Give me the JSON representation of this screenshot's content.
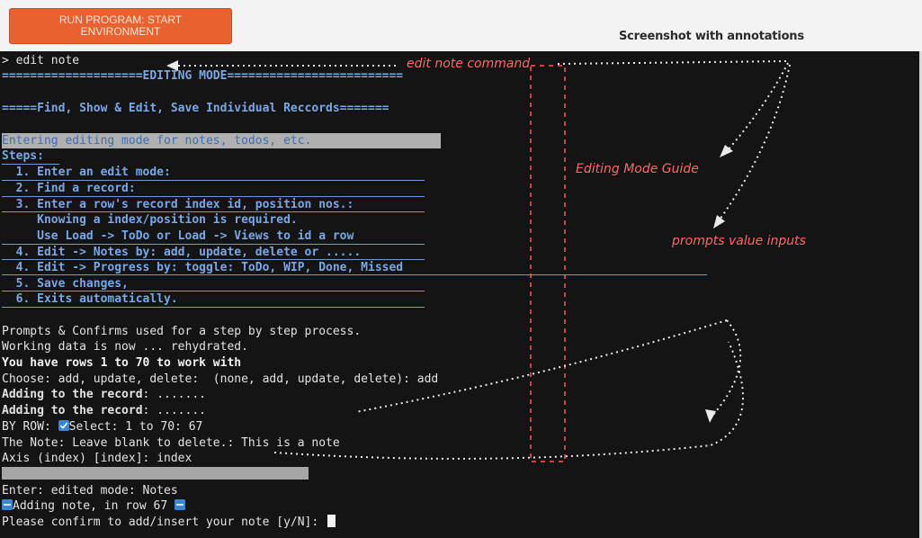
{
  "header": {
    "run_button_line1": "RUN PROGRAM: START",
    "run_button_line2": "ENVIRONMENT",
    "screenshot_caption": "Screenshot with annotations"
  },
  "terminal": {
    "command_line": "> edit note",
    "editing_mode_banner": "====================EDITING MODE=========================",
    "find_banner": "=====Find, Show & Edit, Save Individual Reccords=======",
    "entering_line": "Entering editing mode for notes, todos, etc.",
    "steps_label": "Steps:",
    "steps": [
      "  1. Enter an edit mode:",
      "  2. Find a record:",
      "  3. Enter a row's record index id, position nos.:",
      "     Knowing a index/position is required.",
      "     Use Load -> ToDo or Load -> Views to id a row",
      "  4. Edit -> Notes by: add, update, delete or .....",
      "  4. Edit -> Progress by: toggle: ToDo, WIP, Done, Missed",
      "  5. Save changes,",
      "  6. Exits automatically."
    ],
    "prompts_line": "Prompts & Confirms used for a step by step process.",
    "working_line": "Working data is now ... rehydrated.",
    "rows_line": "You have rows 1 to 70 to work with",
    "choose_prompt": "Choose: add, update, delete:  (none, add, update, delete): ",
    "choose_value": "add",
    "adding_label": "Adding to the record",
    "adding_suffix": ": .......",
    "byrow_prefix": "BY ROW: ",
    "byrow_prompt": "Select: 1 to 70: ",
    "byrow_value": "67",
    "note_prompt": "The Note: Leave blank to delete.: ",
    "note_value": "This is a note",
    "axis_prompt": "Axis (index) [index]: ",
    "axis_value": "index",
    "entered_line": "Enter: edited mode: Notes",
    "adding_note_line": "Adding note, in row 67 ",
    "confirm_prompt": "Please confirm to add/insert your note [y/N]: "
  },
  "annotations": {
    "edit_note_command": "edit note command",
    "editing_mode_guide": "Editing Mode Guide",
    "prompts_value_inputs": "prompts value inputs"
  },
  "colors": {
    "run_button": "#e7622f",
    "terminal_bg": "#141414",
    "terminal_text": "#e3e3e3",
    "section_blue": "#7aa8e6",
    "annotation_red": "#ff6868"
  },
  "icons": [
    "checkmark-icon",
    "new-badge-icon"
  ]
}
